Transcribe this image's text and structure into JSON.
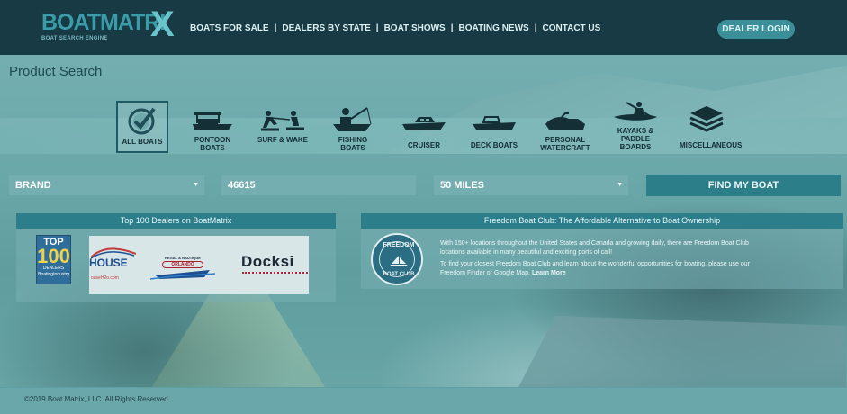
{
  "header": {
    "logo_text": "BOATMATRI",
    "logo_x": "X",
    "logo_tagline": "BOAT SEARCH ENGINE",
    "nav": [
      "BOATS FOR SALE",
      "DEALERS BY STATE",
      "BOAT SHOWS",
      "BOATING NEWS",
      "CONTACT US"
    ],
    "nav_separator": "|",
    "dealer_login": "DEALER LOGIN"
  },
  "page_title": "Product Search",
  "categories": [
    {
      "label": "ALL BOATS",
      "icon": "check-circle-icon",
      "selected": true
    },
    {
      "label": "PONTOON BOATS",
      "icon": "pontoon-boat-icon",
      "selected": false
    },
    {
      "label": "SURF & WAKE",
      "icon": "wakeboard-icon",
      "selected": false
    },
    {
      "label": "FISHING BOATS",
      "icon": "fishing-boat-icon",
      "selected": false
    },
    {
      "label": "CRUISER",
      "icon": "cruiser-icon",
      "selected": false
    },
    {
      "label": "DECK BOATS",
      "icon": "deck-boat-icon",
      "selected": false
    },
    {
      "label": "PERSONAL WATERCRAFT",
      "icon": "jet-ski-icon",
      "selected": false
    },
    {
      "label": "KAYAKS & PADDLE BOARDS",
      "icon": "kayak-icon",
      "selected": false
    },
    {
      "label": "MISCELLANEOUS",
      "icon": "layers-icon",
      "selected": false
    }
  ],
  "search": {
    "brand": "BRAND",
    "zip": "46615",
    "distance": "50 MILES",
    "submit": "FIND MY BOAT"
  },
  "dealers_panel": {
    "title": "Top 100 Dealers on BoatMatrix",
    "badge_top": "TOP",
    "badge_num": "100",
    "badge_sub": "DEALERS",
    "badge_site": "BoatingIndustry",
    "logo1": "HOUSE",
    "logo1_sub": "ouseH2o.com",
    "logo2_top": "REGAL & NAUTIQUE",
    "logo2_main": "ORLANDO",
    "logo3": "Docksi"
  },
  "fbc_panel": {
    "title": "Freedom Boat Club: The Affordable Alternative to Boat Ownership",
    "emblem_top": "FREEDOM",
    "emblem_bottom": "BOAT CLUB",
    "para1": "With 150+ locations throughout the United States and Canada and growing daily, there are Freedom Boat Club locations available in many beautiful and exciting ports of call!",
    "para2": "To find your closest Freedom Boat Club and learn about the wonderful opportunities for boating, please use our Freedom Finder or Google Map.",
    "more": "Learn More"
  },
  "footer": "©2019 Boat Matrix, LLC. All Rights Reserved."
}
